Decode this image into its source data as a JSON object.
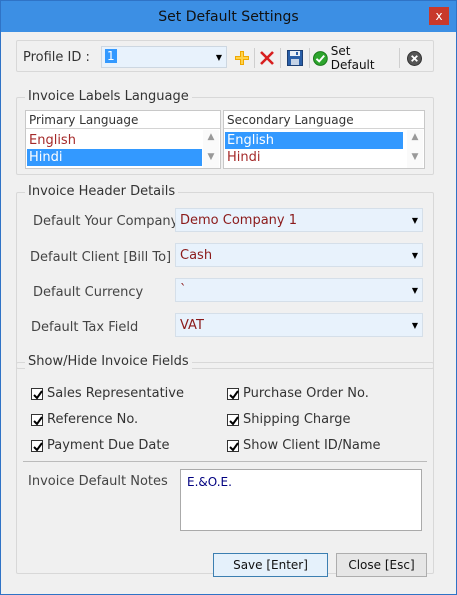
{
  "window": {
    "title": "Set Default Settings",
    "close_glyph": "x"
  },
  "toolbar": {
    "profile_label": "Profile ID :",
    "profile_value": "1",
    "icons": {
      "add": "add-icon",
      "delete": "delete-icon",
      "save": "save-icon",
      "set_default": "check-circle-icon",
      "close": "close-circle-icon"
    },
    "set_default_label": "Set Default"
  },
  "labels_language": {
    "title": "Invoice Labels Language",
    "primary_header": "Primary Language",
    "secondary_header": "Secondary Language",
    "primary_items": [
      "English",
      "Hindi"
    ],
    "primary_selected_index": 1,
    "secondary_items": [
      "English",
      "Hindi"
    ],
    "secondary_selected_index": 0
  },
  "header_details": {
    "title": "Invoice Header Details",
    "fields": [
      {
        "label": "Default Your Company",
        "value": "Demo Company 1"
      },
      {
        "label": "Default Client [Bill To]",
        "value": "Cash"
      },
      {
        "label": "Default Currency",
        "value": "`"
      },
      {
        "label": "Default Tax Field",
        "value": "VAT"
      }
    ]
  },
  "fields_visibility": {
    "title": "Show/Hide Invoice Fields",
    "checkboxes": [
      {
        "label": "Sales Representative",
        "checked": true
      },
      {
        "label": "Purchase Order No.",
        "checked": true
      },
      {
        "label": "Reference No.",
        "checked": true
      },
      {
        "label": "Shipping Charge",
        "checked": true
      },
      {
        "label": "Payment Due Date",
        "checked": true
      },
      {
        "label": "Show Client ID/Name",
        "checked": true
      }
    ],
    "notes_label": "Invoice Default Notes",
    "notes_value": "E.&O.E."
  },
  "buttons": {
    "save": "Save [Enter]",
    "close": "Close [Esc]"
  },
  "colors": {
    "titlebar": "#3c8fe4",
    "selection": "#3399ff",
    "value_text": "#8b1a1a"
  }
}
